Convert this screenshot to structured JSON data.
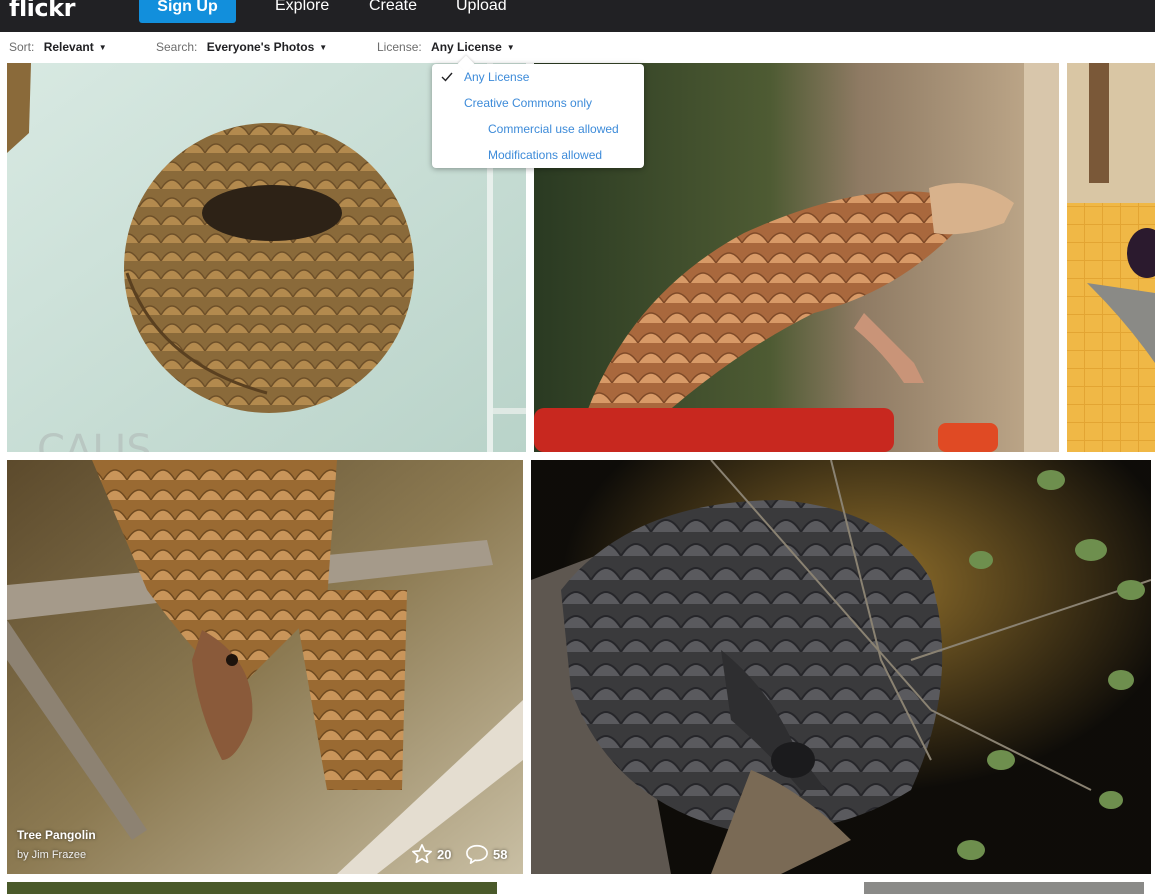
{
  "nav": {
    "logo": "flickr",
    "signup_label": "Sign Up",
    "links": [
      "Explore",
      "Create",
      "Upload"
    ]
  },
  "filters": {
    "sort_label": "Sort:",
    "sort_value": "Relevant",
    "search_label": "Search:",
    "search_value": "Everyone's Photos",
    "license_label": "License:",
    "license_value": "Any License"
  },
  "license_menu": {
    "items": [
      "Any License",
      "Creative Commons only",
      "Commercial use allowed",
      "Modifications allowed"
    ],
    "selected": "Any License"
  },
  "photo_hover": {
    "title": "Tree Pangolin",
    "author": "by Jim Frazee",
    "faves": "20",
    "comments": "58"
  },
  "icons": {
    "check": "check-icon",
    "caret": "caret-down-icon",
    "star": "star-icon",
    "comment": "comment-icon"
  },
  "colors": {
    "topbar": "#212124",
    "signup": "#128fdc",
    "link_blue": "#3d8bd9"
  }
}
